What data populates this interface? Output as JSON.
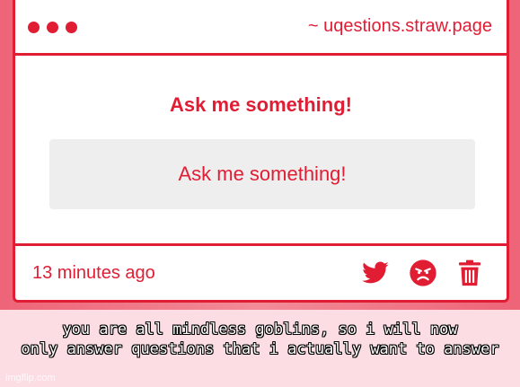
{
  "window": {
    "address": "~ uqestions.straw.page"
  },
  "main": {
    "heading": "Ask me something!",
    "input_placeholder": "Ask me something!"
  },
  "footer": {
    "timestamp": "13 minutes ago",
    "icons": [
      "twitter-icon",
      "angry-face-icon",
      "trash-icon"
    ]
  },
  "caption": {
    "text": "you are all mindless goblins, so i will now\nonly answer questions that i actually want to answer"
  },
  "watermark": {
    "text": "imgflip.com"
  },
  "colors": {
    "accent": "#e11d34",
    "input_bg": "#eeeeee",
    "page_bg": "#fbdde3"
  }
}
